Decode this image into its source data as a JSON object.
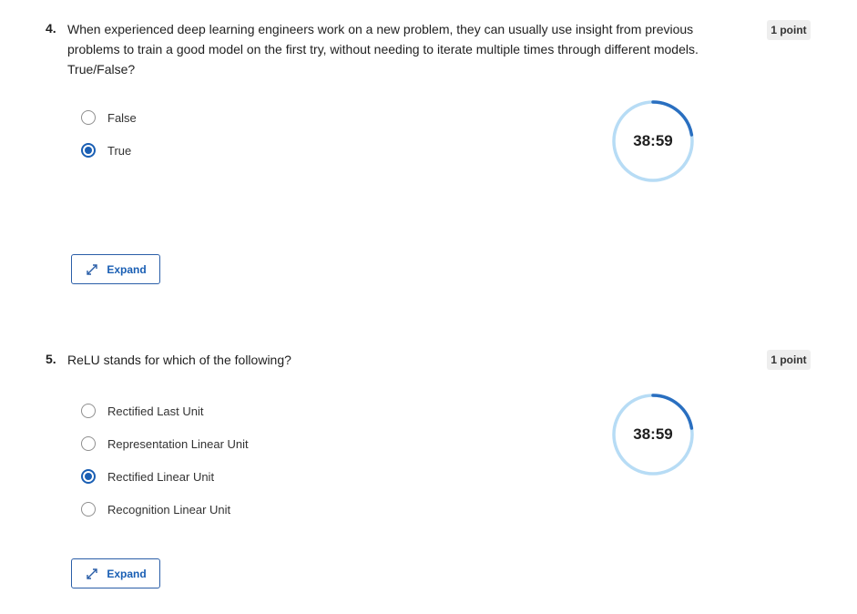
{
  "questions": [
    {
      "number": "4.",
      "text": "When experienced deep learning engineers work on a new problem, they can usually use insight from previous problems to train a good model on the first try, without needing to iterate multiple times through different models. True/False?",
      "points": "1 point",
      "options": [
        {
          "label": "False",
          "selected": false
        },
        {
          "label": "True",
          "selected": true
        }
      ],
      "timer": "38:59",
      "expand_label": "Expand"
    },
    {
      "number": "5.",
      "text": "ReLU stands for which of the following?",
      "points": "1 point",
      "options": [
        {
          "label": "Rectified Last Unit",
          "selected": false
        },
        {
          "label": "Representation Linear Unit",
          "selected": false
        },
        {
          "label": "Rectified Linear Unit",
          "selected": true
        },
        {
          "label": "Recognition Linear Unit",
          "selected": false
        }
      ],
      "timer": "38:59",
      "expand_label": "Expand"
    }
  ],
  "colors": {
    "accent": "#1a5fb4",
    "timer_track": "#b7dcf5",
    "timer_progress": "#2a6fc0",
    "badge_bg": "#eeeeee"
  },
  "icons": {
    "radio": "radio-button",
    "expand": "expand-arrows-icon"
  }
}
